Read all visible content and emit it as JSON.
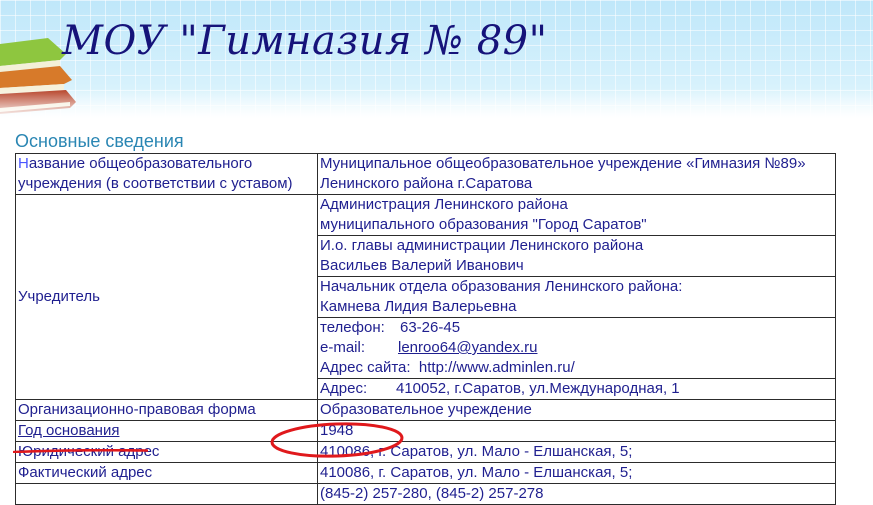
{
  "header": {
    "title": "МОУ \"Гимназия № 89\""
  },
  "section": {
    "title": "Основные сведения"
  },
  "rows": {
    "name": {
      "label_first_letter": "Н",
      "label_rest": "азвание общеобразовательного",
      "label_line2": "учреждения (в соответствии с уставом)",
      "value_line1": "Муниципальное общеобразовательное учреждение «Гимназия №89»",
      "value_line2": "Ленинского района г.Саратова"
    },
    "founder": {
      "label": "Учредитель",
      "admin_line1": "Администрация Ленинского района",
      "admin_line2": "муниципального образования \"Город Саратов\"",
      "head_line1": "И.о. главы администрации Ленинского района",
      "head_line2": "Васильев Валерий Иванович",
      "edu_line1": "Начальник отдела образования Ленинского района:",
      "edu_line2": "Камнева Лидия Валерьевна",
      "phone_label": "телефон:",
      "phone_value": "63-26-45",
      "email_label": "e-mail:",
      "email_value": "lenroo64@yandex.ru",
      "site_label": "Адрес сайта:",
      "site_value": "http://www.adminlen.ru/",
      "address_label": "Адрес:",
      "address_value": "410052, г.Саратов, ул.Международная, 1"
    },
    "legal_form": {
      "label": "Организационно-правовая форма",
      "value": "Образовательное учреждение"
    },
    "founded": {
      "label": "Год основания",
      "value": "1948"
    },
    "legal_address": {
      "label": "Юридический адрес",
      "value": "410086,  г. Саратов, ул. Мало - Елшанская, 5;"
    },
    "actual_address": {
      "label": "Фактический адрес",
      "value": "410086,  г. Саратов, ул. Мало - Елшанская, 5;"
    },
    "phones": {
      "value": "(845-2) 257-280, (845-2) 257-278"
    }
  },
  "colors": {
    "text": "#1f1f8f",
    "title": "#16137a",
    "section_title": "#2a86b3",
    "annotation": "#e0191c"
  }
}
